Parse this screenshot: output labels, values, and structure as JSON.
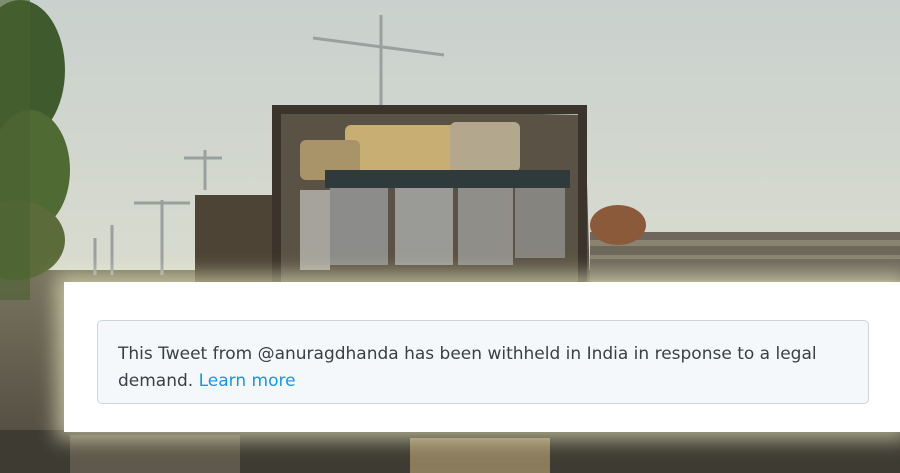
{
  "notice": {
    "message": "This Tweet from @anuragdhanda has been withheld in India in response to a legal demand.",
    "link_label": "Learn more",
    "link_color": "#1b95e0"
  },
  "photo": {
    "subject": "truck-with-boxed-machines",
    "sky_color": "#cfd6cf"
  }
}
